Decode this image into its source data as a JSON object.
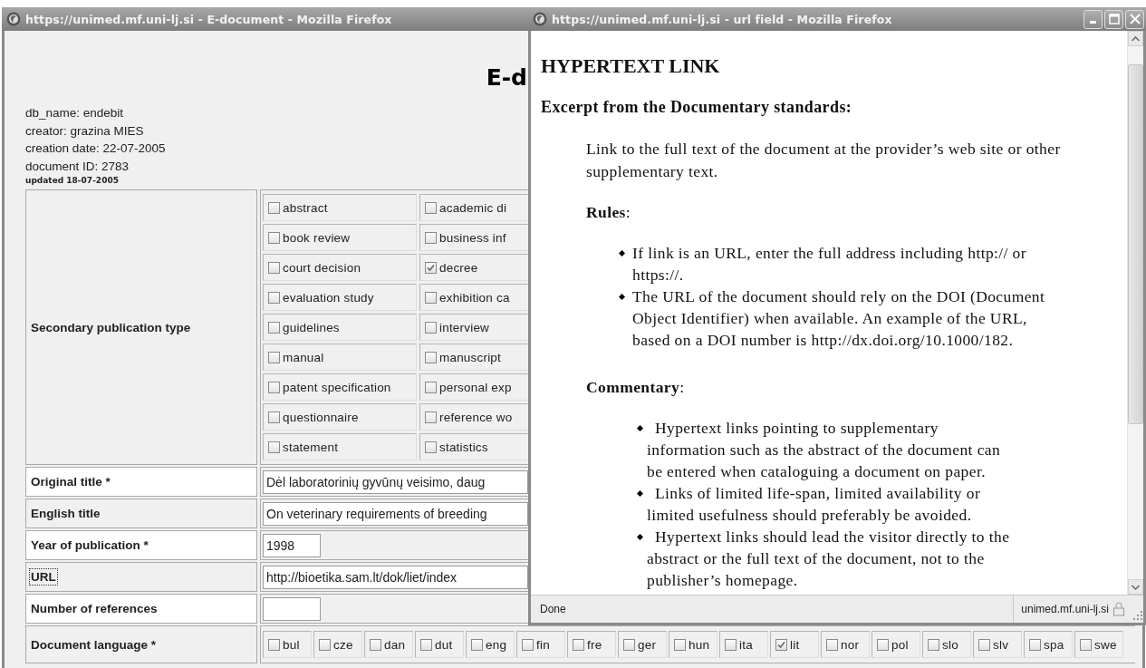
{
  "main_window": {
    "title": "https://unimed.mf.uni-lj.si - E-document - Mozilla Firefox",
    "heading": "E-d",
    "meta": [
      "db_name: endebit",
      "creator: grazina MIES",
      "creation date: 22-07-2005",
      "document ID: 2783"
    ],
    "updated": "updated 18-07-2005",
    "publication_type": {
      "label": "Secondary publication type",
      "options": [
        {
          "label": "abstract",
          "checked": false
        },
        {
          "label": "academic di",
          "checked": false
        },
        {
          "label": "book review",
          "checked": false
        },
        {
          "label": "business inf",
          "checked": false
        },
        {
          "label": "court decision",
          "checked": false
        },
        {
          "label": "decree",
          "checked": true
        },
        {
          "label": "evaluation study",
          "checked": false
        },
        {
          "label": "exhibition ca",
          "checked": false
        },
        {
          "label": "guidelines",
          "checked": false
        },
        {
          "label": "interview",
          "checked": false
        },
        {
          "label": "manual",
          "checked": false
        },
        {
          "label": "manuscript",
          "checked": false
        },
        {
          "label": "patent specification",
          "checked": false
        },
        {
          "label": "personal exp",
          "checked": false
        },
        {
          "label": "questionnaire",
          "checked": false
        },
        {
          "label": "reference wo",
          "checked": false
        },
        {
          "label": "statement",
          "checked": false
        },
        {
          "label": "statistics",
          "checked": false
        }
      ]
    },
    "fields": [
      {
        "label": "Original title *",
        "value": "Dėl laboratorinių gyvūnų veisimo, daug",
        "kind": "wide",
        "focused": false
      },
      {
        "label": "English title",
        "value": "On veterinary requirements of breeding",
        "kind": "wide",
        "focused": false
      },
      {
        "label": "Year of publication *",
        "value": "1998",
        "kind": "short",
        "focused": false
      },
      {
        "label": "URL",
        "value": "http://bioetika.sam.lt/dok/liet/index",
        "kind": "wide",
        "focused": true
      },
      {
        "label": "Number of references",
        "kind": "short",
        "focused": false
      }
    ],
    "language": {
      "label": "Document language *",
      "options": [
        {
          "label": "bul",
          "checked": false
        },
        {
          "label": "cze",
          "checked": false
        },
        {
          "label": "dan",
          "checked": false
        },
        {
          "label": "dut",
          "checked": false
        },
        {
          "label": "eng",
          "checked": false
        },
        {
          "label": "fin",
          "checked": false
        },
        {
          "label": "fre",
          "checked": false
        },
        {
          "label": "ger",
          "checked": false
        },
        {
          "label": "hun",
          "checked": false
        },
        {
          "label": "ita",
          "checked": false
        },
        {
          "label": "lit",
          "checked": true
        },
        {
          "label": "nor",
          "checked": false
        },
        {
          "label": "pol",
          "checked": false
        },
        {
          "label": "slo",
          "checked": false
        },
        {
          "label": "slv",
          "checked": false
        },
        {
          "label": "spa",
          "checked": false
        },
        {
          "label": "swe",
          "checked": false
        }
      ]
    }
  },
  "popup": {
    "title": "https://unimed.mf.uni-lj.si - url field - Mozilla Firefox",
    "heading": "HYPERTEXT LINK",
    "subheading": "Excerpt from the Documentary standards:",
    "intro": "Link to the full text of the document at the provider’s web site or other supplementary text.",
    "sections": [
      {
        "title": "**Rules**:",
        "kind": "list",
        "items": [
          "If link is an URL, enter the full address including http:// or https://.",
          "The URL of the document should rely on the DOI (Document Object Identifier) when available. An example of the URL, based on a DOI number is http://dx.doi.org/10.1000/182."
        ]
      },
      {
        "title": "**Commentary**:",
        "kind": "inline",
        "items": [
          "Hypertext links pointing to supplementary information such as the abstract of the document can be entered when cataloguing a document on paper.",
          "Links of limited life-span, limited availability or limited usefulness should preferably be avoided.",
          "Hypertext links should lead the visitor directly to the abstract or the full text of the document, not to the publisher’s homepage."
        ]
      }
    ],
    "status": "Done",
    "host": "unimed.mf.uni-lj.si"
  }
}
